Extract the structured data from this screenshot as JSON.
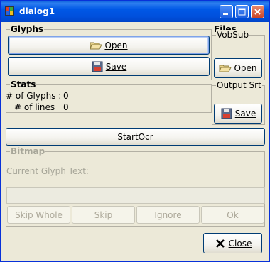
{
  "window": {
    "title": "dialog1",
    "icon": "app-cube-icon"
  },
  "glyphs": {
    "legend": "Glyphs",
    "open_label": "Open",
    "save_label": "Save"
  },
  "stats": {
    "legend": "Stats",
    "glyphs_label": "# of Glyphs :",
    "glyphs_value": "0",
    "lines_label": "# of lines",
    "lines_value": "0"
  },
  "files": {
    "legend": "Files",
    "vobsub_legend": "VobSub",
    "open_label": "Open",
    "output_legend": "Output Srt",
    "save_label": "Save"
  },
  "start_ocr": {
    "label": "StartOcr"
  },
  "bitmap": {
    "legend": "Bitmap",
    "current_glyph_label": "Current Glyph Text:",
    "buttons": [
      "Skip Whole",
      "Skip",
      "Ignore",
      "Ok"
    ]
  },
  "close": {
    "label": "Close"
  },
  "colors": {
    "titlebar": "#0058e6",
    "window_bg": "#ece9d8",
    "button_border": "#003c74",
    "close_button": "#c9452a"
  }
}
